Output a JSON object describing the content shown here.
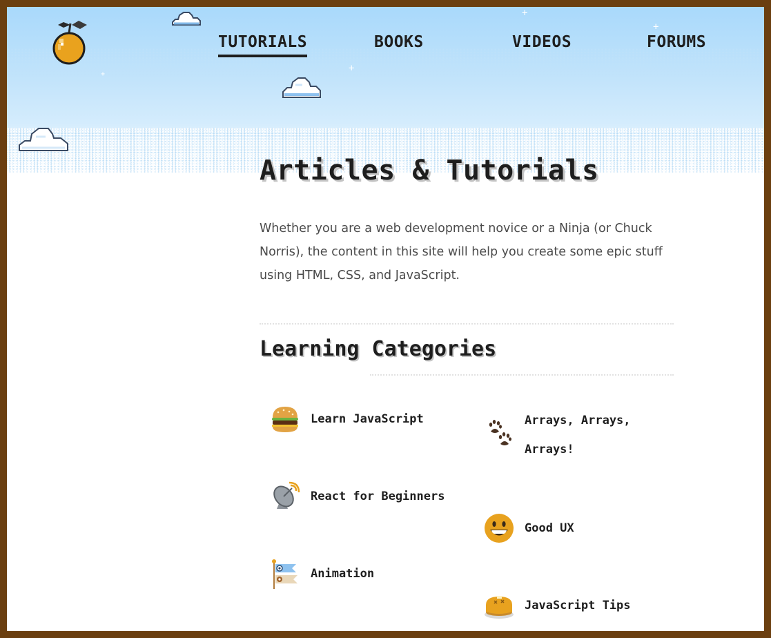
{
  "nav": {
    "items": [
      {
        "label": "TUTORIALS",
        "active": true
      },
      {
        "label": "BOOKS",
        "active": false
      },
      {
        "label": "VIDEOS",
        "active": false
      },
      {
        "label": "FORUMS",
        "active": false
      }
    ]
  },
  "logo": {
    "icon": "orange-fruit-icon"
  },
  "page": {
    "title": "Articles & Tutorials",
    "intro": "Whether you are a web development novice or a Ninja (or Chuck Norris), the content in this site will help you create some epic stuff using HTML, CSS, and JavaScript."
  },
  "categories": {
    "heading": "Learning Categories",
    "items": [
      {
        "label": "Learn JavaScript",
        "icon": "hamburger-icon"
      },
      {
        "label": "Arrays, Arrays, Arrays!",
        "icon": "paw-prints-icon"
      },
      {
        "label": "React for Beginners",
        "icon": "satellite-dish-icon"
      },
      {
        "label": "Good UX",
        "icon": "grinning-face-icon"
      },
      {
        "label": "Animation",
        "icon": "carp-streamer-icon"
      },
      {
        "label": "JavaScript Tips",
        "icon": "pancake-icon"
      }
    ]
  },
  "colors": {
    "sky": "#a9d9fb",
    "border": "#6b3f10",
    "text": "#1e1e1e"
  }
}
